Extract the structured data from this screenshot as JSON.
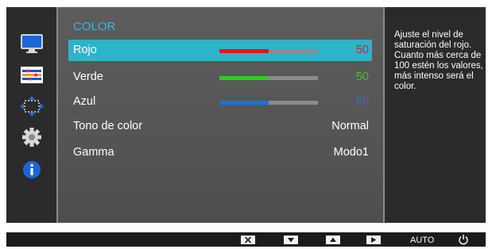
{
  "menu": {
    "title": "COLOR",
    "rows": [
      {
        "label": "Rojo",
        "value": "50",
        "level": 0.5,
        "color": "#e8141c",
        "value_color": "#e8141c",
        "selected": true
      },
      {
        "label": "Verde",
        "value": "50",
        "level": 0.5,
        "color": "#27d11b",
        "value_color": "#2fd11b"
      },
      {
        "label": "Azul",
        "value": "50",
        "level": 0.5,
        "color": "#1f6fe0",
        "value_color": "#2f6fd8"
      },
      {
        "label": "Tono de color",
        "value": "Normal"
      },
      {
        "label": "Gamma",
        "value": "Modo1"
      }
    ]
  },
  "help": {
    "text": "Ajuste el nivel de saturación del rojo. Cuanto más cerca de 100 estén los valores, más intenso será el color."
  },
  "sidebar": {
    "items": [
      {
        "icon": "monitor-icon"
      },
      {
        "icon": "color-adjust-icon",
        "active": true
      },
      {
        "icon": "size-position-icon"
      },
      {
        "icon": "settings-gear-icon"
      },
      {
        "icon": "information-icon"
      }
    ]
  },
  "controls": {
    "buttons": [
      "close-icon",
      "down-arrow-icon",
      "up-arrow-icon",
      "right-arrow-icon"
    ],
    "auto_label": "AUTO",
    "power_icon": "power-icon"
  },
  "colors": {
    "accent": "#2cb4c8",
    "title": "#3fb1e6",
    "panel": "#555555",
    "background": "#2d2d2d"
  }
}
